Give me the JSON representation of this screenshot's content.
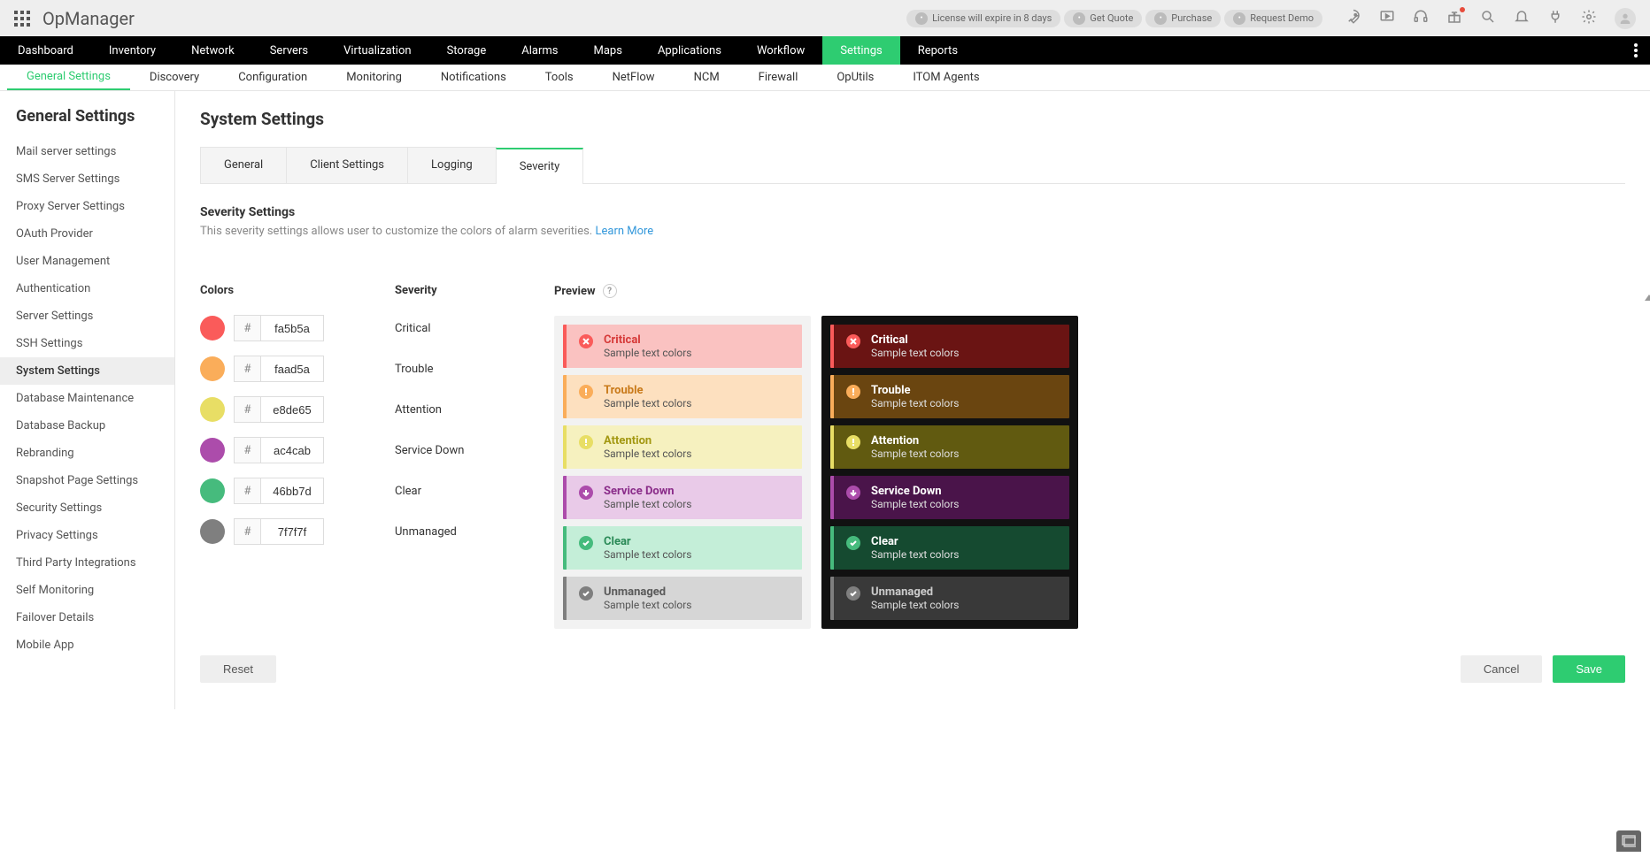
{
  "brand": "OpManager",
  "top_pills": [
    {
      "label": "License will expire in 8 days"
    },
    {
      "label": "Get Quote"
    },
    {
      "label": "Purchase"
    },
    {
      "label": "Request Demo"
    }
  ],
  "mainnav": [
    "Dashboard",
    "Inventory",
    "Network",
    "Servers",
    "Virtualization",
    "Storage",
    "Alarms",
    "Maps",
    "Applications",
    "Workflow",
    "Settings",
    "Reports"
  ],
  "mainnav_active": "Settings",
  "subnav": [
    "General Settings",
    "Discovery",
    "Configuration",
    "Monitoring",
    "Notifications",
    "Tools",
    "NetFlow",
    "NCM",
    "Firewall",
    "OpUtils",
    "ITOM Agents"
  ],
  "subnav_active": "General Settings",
  "sidebar_title": "General Settings",
  "sidebar_items": [
    "Mail server settings",
    "SMS Server Settings",
    "Proxy Server Settings",
    "OAuth Provider",
    "User Management",
    "Authentication",
    "Server Settings",
    "SSH Settings",
    "System Settings",
    "Database Maintenance",
    "Database Backup",
    "Rebranding",
    "Snapshot Page Settings",
    "Security Settings",
    "Privacy Settings",
    "Third Party Integrations",
    "Self Monitoring",
    "Failover Details",
    "Mobile App"
  ],
  "sidebar_active": "System Settings",
  "page_title": "System Settings",
  "tabs": [
    "General",
    "Client Settings",
    "Logging",
    "Severity"
  ],
  "tab_active": "Severity",
  "section": {
    "title": "Severity Settings",
    "desc": "This severity settings allows user to customize the colors of alarm severities.",
    "learn_more": "Learn More"
  },
  "headers": {
    "colors": "Colors",
    "severity": "Severity",
    "preview": "Preview"
  },
  "sample_text": "Sample text colors",
  "severities": [
    {
      "name": "Critical",
      "hex": "fa5b5a",
      "icon": "x",
      "light_bg": "#fac2c1",
      "light_fg": "#d63a39",
      "dark_bg": "#6a1413",
      "dark_fg": "#ffffff"
    },
    {
      "name": "Trouble",
      "hex": "faad5a",
      "icon": "excl",
      "light_bg": "#fde0bf",
      "light_fg": "#c97a1a",
      "dark_bg": "#6a4510",
      "dark_fg": "#ffffff"
    },
    {
      "name": "Attention",
      "hex": "e8de65",
      "icon": "excl",
      "light_bg": "#f6f1bf",
      "light_fg": "#a39812",
      "dark_bg": "#615a10",
      "dark_fg": "#ffffff"
    },
    {
      "name": "Service Down",
      "hex": "ac4cab",
      "icon": "arrow",
      "light_bg": "#e9cae8",
      "light_fg": "#8a2c89",
      "dark_bg": "#4a144a",
      "dark_fg": "#ffffff"
    },
    {
      "name": "Clear",
      "hex": "46bb7d",
      "icon": "check",
      "light_bg": "#c4eed8",
      "light_fg": "#2a8a57",
      "dark_bg": "#154a30",
      "dark_fg": "#ffffff"
    },
    {
      "name": "Unmanaged",
      "hex": "7f7f7f",
      "icon": "check",
      "light_bg": "#d6d6d6",
      "light_fg": "#5a5a5a",
      "dark_bg": "#393939",
      "dark_fg": "#cccccc"
    }
  ],
  "buttons": {
    "reset": "Reset",
    "cancel": "Cancel",
    "save": "Save"
  }
}
